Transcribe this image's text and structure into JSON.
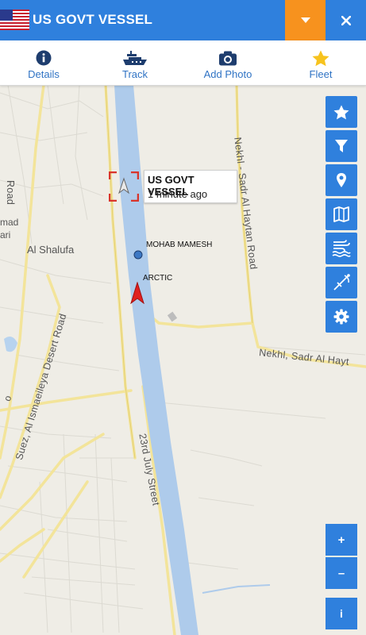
{
  "header": {
    "title": "US GOVT VESSEL",
    "flag_icon": "us-flag-icon",
    "dropdown_icon": "caret-down-icon",
    "close_icon": "close-icon",
    "accent_color": "#2f80dd",
    "dropdown_color": "#f7921e"
  },
  "tabs": [
    {
      "label": "Details",
      "icon": "info-icon"
    },
    {
      "label": "Track",
      "icon": "ship-icon"
    },
    {
      "label": "Add Photo",
      "icon": "camera-icon"
    },
    {
      "label": "Fleet",
      "icon": "star-icon"
    }
  ],
  "popup": {
    "vessel_name": "US GOVT VESSEL",
    "last_seen": "1 minute ago"
  },
  "vessels": {
    "mohab": "MOHAB MAMESH",
    "arctic": "ARCTIC"
  },
  "map_labels": {
    "al_shalufa": "Al Shalufa",
    "nekhl_road_v": "Nekhl - Sadr Al Haytan Road",
    "nekhl_road_h": "Nekhl, Sadr Al Hayt",
    "july_street": "23rd July Street",
    "desert_road": "Suez, Al Ismaeileya Desert Road",
    "road_frag": "Road",
    "mad_frag": "mad",
    "ari_frag": "ari",
    "o_frag": "o"
  },
  "toolbar": [
    {
      "name": "favorites-button",
      "icon": "star-icon"
    },
    {
      "name": "filter-button",
      "icon": "filter-icon"
    },
    {
      "name": "location-button",
      "icon": "location-pin-icon"
    },
    {
      "name": "map-layers-button",
      "icon": "map-icon"
    },
    {
      "name": "weather-button",
      "icon": "wind-waves-icon"
    },
    {
      "name": "measure-button",
      "icon": "compass-drafting-icon"
    },
    {
      "name": "settings-button",
      "icon": "gear-icon"
    }
  ],
  "zoom": {
    "in_label": "+",
    "out_label": "–"
  },
  "info_button": {
    "label": "i"
  }
}
